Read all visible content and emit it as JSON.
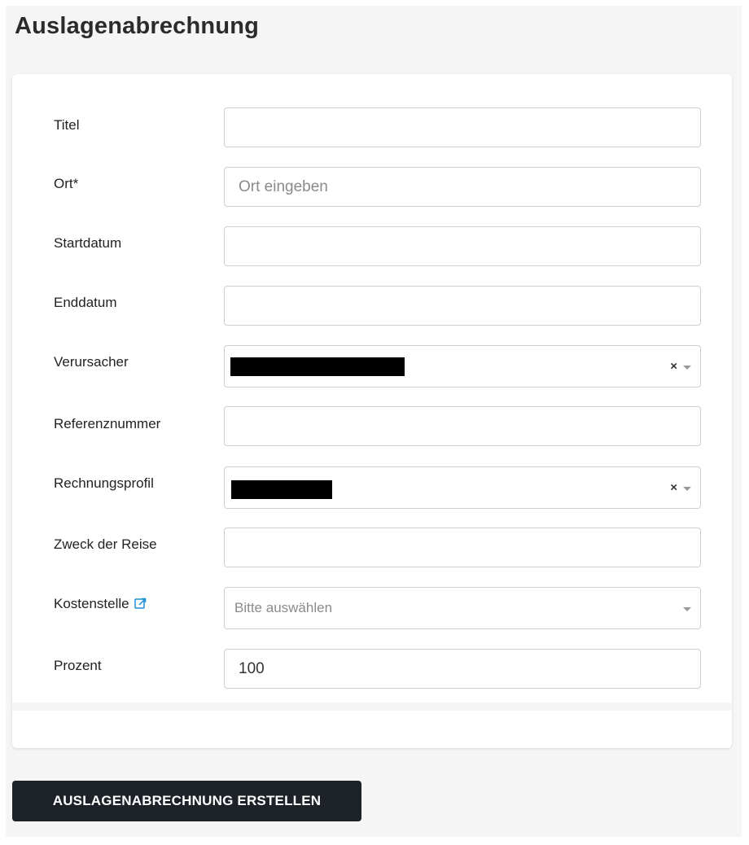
{
  "page": {
    "title": "Auslagenabrechnung"
  },
  "form": {
    "titel": {
      "label": "Titel",
      "value": "",
      "placeholder": ""
    },
    "ort": {
      "label": "Ort*",
      "value": "",
      "placeholder": "Ort eingeben"
    },
    "startdatum": {
      "label": "Startdatum",
      "value": ""
    },
    "enddatum": {
      "label": "Enddatum",
      "value": ""
    },
    "verursacher": {
      "label": "Verursacher",
      "clear": "×"
    },
    "referenznummer": {
      "label": "Referenznummer",
      "value": ""
    },
    "rechnungsprofil": {
      "label": "Rechnungsprofil",
      "clear": "×"
    },
    "zweck": {
      "label": "Zweck der Reise",
      "value": ""
    },
    "kostenstelle": {
      "label": "Kostenstelle",
      "placeholder": "Bitte auswählen",
      "link_icon": "external-link-icon"
    },
    "prozent": {
      "label": "Prozent",
      "value": "100"
    }
  },
  "submit": {
    "label": "AUSLAGENABRECHNUNG ERSTELLEN"
  },
  "colors": {
    "accent": "#1d8fd6",
    "button_bg": "#1d2128",
    "page_bg": "#f5f5f5"
  }
}
